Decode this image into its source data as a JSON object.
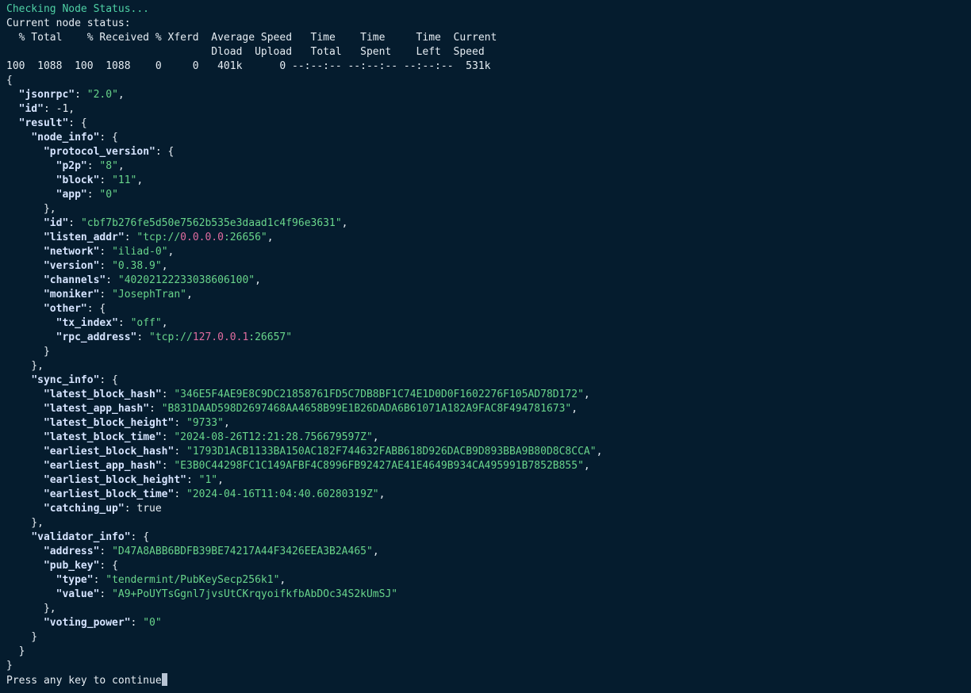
{
  "colors": {
    "background": "#051c2e",
    "heading": "#4fd1a5",
    "text": "#e6edf3",
    "key": "#d6e4ff",
    "string": "#69d58b",
    "highlight": "#e06c9f",
    "cursor": "#b8c4d4"
  },
  "lines": [
    [
      {
        "text": "Checking Node Status...",
        "c": "green"
      }
    ],
    [
      {
        "text": "Current node status:",
        "c": "white"
      }
    ],
    [
      {
        "text": "  % Total    % Received % Xferd  Average Speed   Time    Time     Time  Current",
        "c": "white"
      }
    ],
    [
      {
        "text": "                                 Dload  Upload   Total   Spent    Left  Speed",
        "c": "white"
      }
    ],
    [
      {
        "text": "100  1088  100  1088    0     0   401k      0 --:--:-- --:--:-- --:--:--  531k",
        "c": "white"
      }
    ],
    [
      {
        "text": "{",
        "c": "plain"
      }
    ],
    [
      {
        "text": "  ",
        "c": "plain"
      },
      {
        "text": "\"jsonrpc\"",
        "c": "key"
      },
      {
        "text": ": ",
        "c": "plain"
      },
      {
        "text": "\"2.0\"",
        "c": "str"
      },
      {
        "text": ",",
        "c": "plain"
      }
    ],
    [
      {
        "text": "  ",
        "c": "plain"
      },
      {
        "text": "\"id\"",
        "c": "key"
      },
      {
        "text": ": -1,",
        "c": "plain"
      }
    ],
    [
      {
        "text": "  ",
        "c": "plain"
      },
      {
        "text": "\"result\"",
        "c": "key"
      },
      {
        "text": ": {",
        "c": "plain"
      }
    ],
    [
      {
        "text": "    ",
        "c": "plain"
      },
      {
        "text": "\"node_info\"",
        "c": "key"
      },
      {
        "text": ": {",
        "c": "plain"
      }
    ],
    [
      {
        "text": "      ",
        "c": "plain"
      },
      {
        "text": "\"protocol_version\"",
        "c": "key"
      },
      {
        "text": ": {",
        "c": "plain"
      }
    ],
    [
      {
        "text": "        ",
        "c": "plain"
      },
      {
        "text": "\"p2p\"",
        "c": "key"
      },
      {
        "text": ": ",
        "c": "plain"
      },
      {
        "text": "\"8\"",
        "c": "str"
      },
      {
        "text": ",",
        "c": "plain"
      }
    ],
    [
      {
        "text": "        ",
        "c": "plain"
      },
      {
        "text": "\"block\"",
        "c": "key"
      },
      {
        "text": ": ",
        "c": "plain"
      },
      {
        "text": "\"11\"",
        "c": "str"
      },
      {
        "text": ",",
        "c": "plain"
      }
    ],
    [
      {
        "text": "        ",
        "c": "plain"
      },
      {
        "text": "\"app\"",
        "c": "key"
      },
      {
        "text": ": ",
        "c": "plain"
      },
      {
        "text": "\"0\"",
        "c": "str"
      }
    ],
    [
      {
        "text": "      },",
        "c": "plain"
      }
    ],
    [
      {
        "text": "      ",
        "c": "plain"
      },
      {
        "text": "\"id\"",
        "c": "key"
      },
      {
        "text": ": ",
        "c": "plain"
      },
      {
        "text": "\"cbf7b276fe5d50e7562b535e3daad1c4f96e3631\"",
        "c": "str"
      },
      {
        "text": ",",
        "c": "plain"
      }
    ],
    [
      {
        "text": "      ",
        "c": "plain"
      },
      {
        "text": "\"listen_addr\"",
        "c": "key"
      },
      {
        "text": ": ",
        "c": "plain"
      },
      {
        "text": "\"tcp://",
        "c": "str"
      },
      {
        "text": "0.0.0.0",
        "c": "ip"
      },
      {
        "text": ":26656\"",
        "c": "str"
      },
      {
        "text": ",",
        "c": "plain"
      }
    ],
    [
      {
        "text": "      ",
        "c": "plain"
      },
      {
        "text": "\"network\"",
        "c": "key"
      },
      {
        "text": ": ",
        "c": "plain"
      },
      {
        "text": "\"iliad-0\"",
        "c": "str"
      },
      {
        "text": ",",
        "c": "plain"
      }
    ],
    [
      {
        "text": "      ",
        "c": "plain"
      },
      {
        "text": "\"version\"",
        "c": "key"
      },
      {
        "text": ": ",
        "c": "plain"
      },
      {
        "text": "\"0.38.9\"",
        "c": "str"
      },
      {
        "text": ",",
        "c": "plain"
      }
    ],
    [
      {
        "text": "      ",
        "c": "plain"
      },
      {
        "text": "\"channels\"",
        "c": "key"
      },
      {
        "text": ": ",
        "c": "plain"
      },
      {
        "text": "\"40202122233038606100\"",
        "c": "str"
      },
      {
        "text": ",",
        "c": "plain"
      }
    ],
    [
      {
        "text": "      ",
        "c": "plain"
      },
      {
        "text": "\"moniker\"",
        "c": "key"
      },
      {
        "text": ": ",
        "c": "plain"
      },
      {
        "text": "\"JosephTran\"",
        "c": "str"
      },
      {
        "text": ",",
        "c": "plain"
      }
    ],
    [
      {
        "text": "      ",
        "c": "plain"
      },
      {
        "text": "\"other\"",
        "c": "key"
      },
      {
        "text": ": {",
        "c": "plain"
      }
    ],
    [
      {
        "text": "        ",
        "c": "plain"
      },
      {
        "text": "\"tx_index\"",
        "c": "key"
      },
      {
        "text": ": ",
        "c": "plain"
      },
      {
        "text": "\"off\"",
        "c": "str"
      },
      {
        "text": ",",
        "c": "plain"
      }
    ],
    [
      {
        "text": "        ",
        "c": "plain"
      },
      {
        "text": "\"rpc_address\"",
        "c": "key"
      },
      {
        "text": ": ",
        "c": "plain"
      },
      {
        "text": "\"tcp://",
        "c": "str"
      },
      {
        "text": "127.0.0.1",
        "c": "ip"
      },
      {
        "text": ":26657\"",
        "c": "str"
      }
    ],
    [
      {
        "text": "      }",
        "c": "plain"
      }
    ],
    [
      {
        "text": "    },",
        "c": "plain"
      }
    ],
    [
      {
        "text": "    ",
        "c": "plain"
      },
      {
        "text": "\"sync_info\"",
        "c": "key"
      },
      {
        "text": ": {",
        "c": "plain"
      }
    ],
    [
      {
        "text": "      ",
        "c": "plain"
      },
      {
        "text": "\"latest_block_hash\"",
        "c": "key"
      },
      {
        "text": ": ",
        "c": "plain"
      },
      {
        "text": "\"346E5F4AE9E8C9DC21858761FD5C7DB8BF1C74E1D0D0F1602276F105AD78D172\"",
        "c": "str"
      },
      {
        "text": ",",
        "c": "plain"
      }
    ],
    [
      {
        "text": "      ",
        "c": "plain"
      },
      {
        "text": "\"latest_app_hash\"",
        "c": "key"
      },
      {
        "text": ": ",
        "c": "plain"
      },
      {
        "text": "\"B831DAAD598D2697468AA4658B99E1B26DADA6B61071A182A9FAC8F494781673\"",
        "c": "str"
      },
      {
        "text": ",",
        "c": "plain"
      }
    ],
    [
      {
        "text": "      ",
        "c": "plain"
      },
      {
        "text": "\"latest_block_height\"",
        "c": "key"
      },
      {
        "text": ": ",
        "c": "plain"
      },
      {
        "text": "\"9733\"",
        "c": "str"
      },
      {
        "text": ",",
        "c": "plain"
      }
    ],
    [
      {
        "text": "      ",
        "c": "plain"
      },
      {
        "text": "\"latest_block_time\"",
        "c": "key"
      },
      {
        "text": ": ",
        "c": "plain"
      },
      {
        "text": "\"2024-08-26T12:21:28.756679597Z\"",
        "c": "str"
      },
      {
        "text": ",",
        "c": "plain"
      }
    ],
    [
      {
        "text": "      ",
        "c": "plain"
      },
      {
        "text": "\"earliest_block_hash\"",
        "c": "key"
      },
      {
        "text": ": ",
        "c": "plain"
      },
      {
        "text": "\"1793D1ACB1133BA150AC182F744632FABB618D926DACB9D893BBA9B80D8C8CCA\"",
        "c": "str"
      },
      {
        "text": ",",
        "c": "plain"
      }
    ],
    [
      {
        "text": "      ",
        "c": "plain"
      },
      {
        "text": "\"earliest_app_hash\"",
        "c": "key"
      },
      {
        "text": ": ",
        "c": "plain"
      },
      {
        "text": "\"E3B0C44298FC1C149AFBF4C8996FB92427AE41E4649B934CA495991B7852B855\"",
        "c": "str"
      },
      {
        "text": ",",
        "c": "plain"
      }
    ],
    [
      {
        "text": "      ",
        "c": "plain"
      },
      {
        "text": "\"earliest_block_height\"",
        "c": "key"
      },
      {
        "text": ": ",
        "c": "plain"
      },
      {
        "text": "\"1\"",
        "c": "str"
      },
      {
        "text": ",",
        "c": "plain"
      }
    ],
    [
      {
        "text": "      ",
        "c": "plain"
      },
      {
        "text": "\"earliest_block_time\"",
        "c": "key"
      },
      {
        "text": ": ",
        "c": "plain"
      },
      {
        "text": "\"2024-04-16T11:04:40.60280319Z\"",
        "c": "str"
      },
      {
        "text": ",",
        "c": "plain"
      }
    ],
    [
      {
        "text": "      ",
        "c": "plain"
      },
      {
        "text": "\"catching_up\"",
        "c": "key"
      },
      {
        "text": ": true",
        "c": "plain"
      }
    ],
    [
      {
        "text": "    },",
        "c": "plain"
      }
    ],
    [
      {
        "text": "    ",
        "c": "plain"
      },
      {
        "text": "\"validator_info\"",
        "c": "key"
      },
      {
        "text": ": {",
        "c": "plain"
      }
    ],
    [
      {
        "text": "      ",
        "c": "plain"
      },
      {
        "text": "\"address\"",
        "c": "key"
      },
      {
        "text": ": ",
        "c": "plain"
      },
      {
        "text": "\"D47A8ABB6BDFB39BE74217A44F3426EEA3B2A465\"",
        "c": "str"
      },
      {
        "text": ",",
        "c": "plain"
      }
    ],
    [
      {
        "text": "      ",
        "c": "plain"
      },
      {
        "text": "\"pub_key\"",
        "c": "key"
      },
      {
        "text": ": {",
        "c": "plain"
      }
    ],
    [
      {
        "text": "        ",
        "c": "plain"
      },
      {
        "text": "\"type\"",
        "c": "key"
      },
      {
        "text": ": ",
        "c": "plain"
      },
      {
        "text": "\"tendermint/PubKeySecp256k1\"",
        "c": "str"
      },
      {
        "text": ",",
        "c": "plain"
      }
    ],
    [
      {
        "text": "        ",
        "c": "plain"
      },
      {
        "text": "\"value\"",
        "c": "key"
      },
      {
        "text": ": ",
        "c": "plain"
      },
      {
        "text": "\"A9+PoUYTsGgnl7jvsUtCKrqyoifkfbAbDOc34S2kUmSJ\"",
        "c": "str"
      }
    ],
    [
      {
        "text": "      },",
        "c": "plain"
      }
    ],
    [
      {
        "text": "      ",
        "c": "plain"
      },
      {
        "text": "\"voting_power\"",
        "c": "key"
      },
      {
        "text": ": ",
        "c": "plain"
      },
      {
        "text": "\"0\"",
        "c": "str"
      }
    ],
    [
      {
        "text": "    }",
        "c": "plain"
      }
    ],
    [
      {
        "text": "  }",
        "c": "plain"
      }
    ],
    [
      {
        "text": "}",
        "c": "plain"
      }
    ]
  ],
  "prompt": {
    "text": "Press any key to continue"
  }
}
